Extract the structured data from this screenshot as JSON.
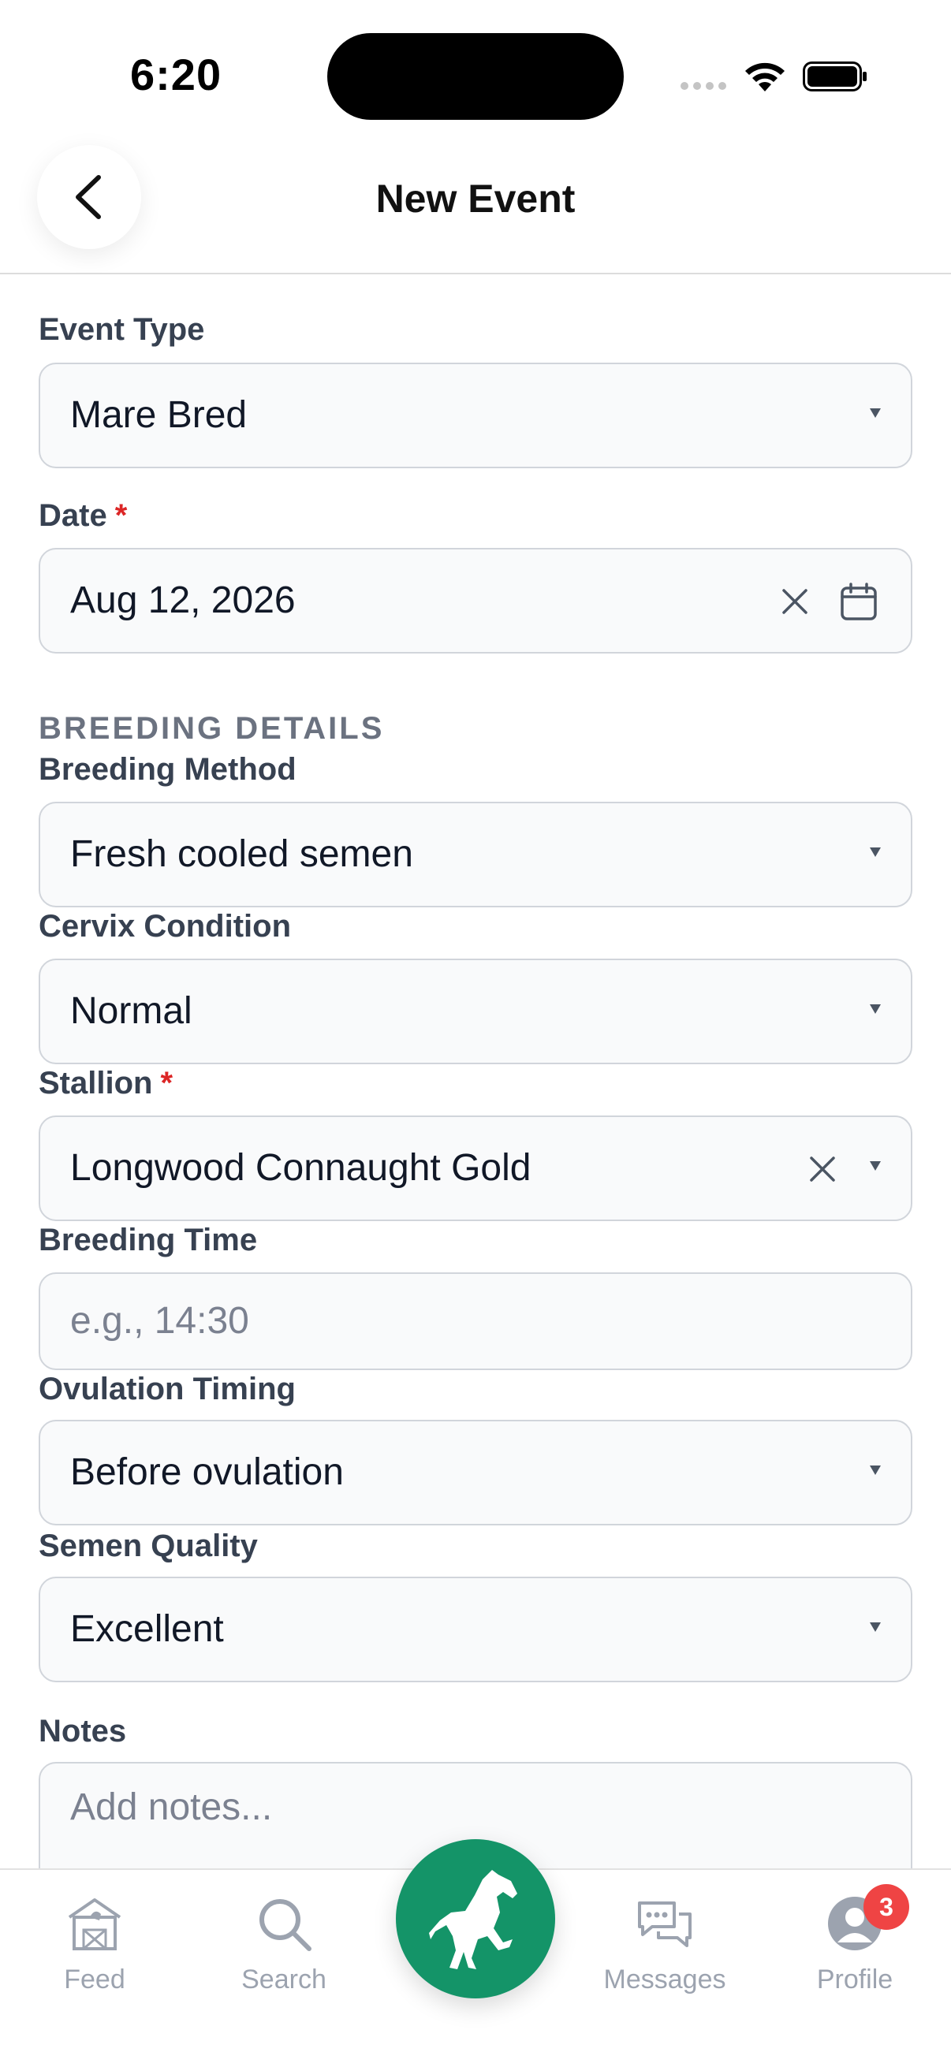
{
  "status_bar": {
    "time": "6:20"
  },
  "header": {
    "title": "New Event",
    "back_icon": "chevron-left-icon"
  },
  "form": {
    "event_type": {
      "label": "Event Type",
      "value": "Mare Bred"
    },
    "date": {
      "label": "Date",
      "required_mark": "*",
      "value": "Aug 12, 2026"
    },
    "section_title": "BREEDING DETAILS",
    "breeding_method": {
      "label": "Breeding Method",
      "value": "Fresh cooled semen"
    },
    "cervix_condition": {
      "label": "Cervix Condition",
      "value": "Normal"
    },
    "stallion": {
      "label": "Stallion",
      "required_mark": "*",
      "value": "Longwood Connaught Gold"
    },
    "breeding_time": {
      "label": "Breeding Time",
      "placeholder": "e.g., 14:30"
    },
    "ovulation_timing": {
      "label": "Ovulation Timing",
      "value": "Before ovulation"
    },
    "semen_quality": {
      "label": "Semen Quality",
      "value": "Excellent"
    },
    "notes": {
      "label": "Notes",
      "placeholder": "Add notes..."
    }
  },
  "bottom_nav": {
    "items": [
      {
        "label": "Feed",
        "icon": "barn-icon"
      },
      {
        "label": "Search",
        "icon": "search-icon"
      },
      {
        "label": "Messages",
        "icon": "chat-bubbles-icon"
      },
      {
        "label": "Profile",
        "icon": "user-icon"
      }
    ],
    "center_icon": "horse-icon",
    "profile_badge": "3"
  },
  "colors": {
    "accent": "#149468",
    "required": "#dc2626",
    "badge": "#ef4444"
  }
}
